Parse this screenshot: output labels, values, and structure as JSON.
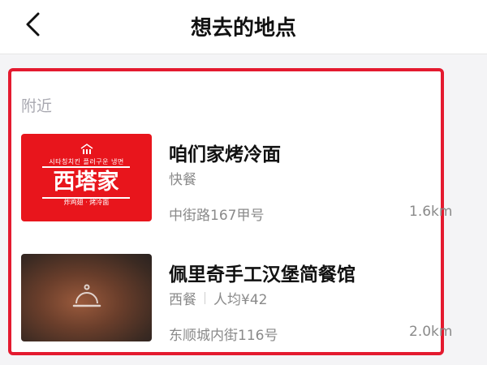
{
  "header": {
    "title": "想去的地点",
    "back_icon": "chevron-left-icon"
  },
  "section": {
    "label": "附近"
  },
  "places": [
    {
      "name": "咱们家烤冷面",
      "category": "快餐",
      "address": "中街路167甲号",
      "distance": "1.6km",
      "logo": {
        "tagline": "시타칭치킨 플러구운 냉면",
        "text": "西塔家",
        "sub": "炸鸡翅 · 烤冷面"
      }
    },
    {
      "name": "佩里奇手工汉堡简餐馆",
      "category": "西餐",
      "price": "人均¥42",
      "address": "东顺城内街116号",
      "distance": "2.0km"
    }
  ],
  "colors": {
    "accent": "#e41a2f",
    "logo_bg": "#e8151c",
    "text_secondary": "#8a8a8a"
  }
}
